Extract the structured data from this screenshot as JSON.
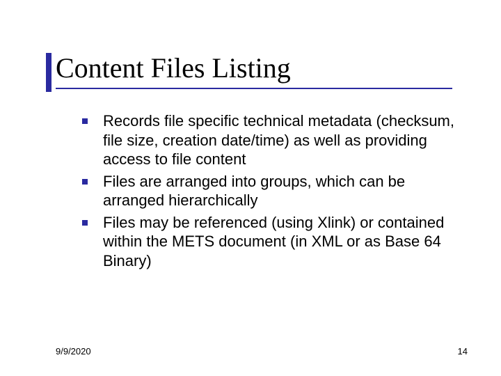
{
  "slide": {
    "title": "Content Files Listing",
    "bullets": [
      "Records file specific technical metadata (checksum, file size, creation date/time) as well as providing access to file content",
      "Files are arranged into groups, which can be arranged hierarchically",
      "Files may be referenced (using Xlink) or contained within the METS document (in XML or as Base 64 Binary)"
    ],
    "footer": {
      "date": "9/9/2020",
      "page_number": "14"
    },
    "colors": {
      "accent": "#2a2aa0"
    }
  }
}
